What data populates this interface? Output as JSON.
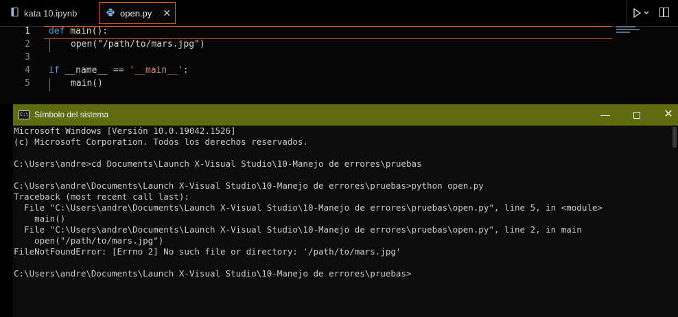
{
  "editor": {
    "tabs": [
      {
        "label": "kata 10.ipynb",
        "icon": "notebook-icon"
      },
      {
        "label": "open.py",
        "icon": "python-icon",
        "close": "✕"
      }
    ],
    "lines": [
      {
        "num": "1"
      },
      {
        "num": "2"
      },
      {
        "num": "3"
      },
      {
        "num": "4"
      },
      {
        "num": "5"
      }
    ],
    "code": {
      "l1_kw": "def",
      "l1_rest": " main():",
      "l2_fn": "open",
      "l2_open": "(",
      "l2_str": "\"/path/to/mars.jpg\"",
      "l2_close": ")",
      "l4_kw": "if",
      "l4_name": " __name__ ",
      "l4_op": "== ",
      "l4_str": "'__main__'",
      "l4_colon": ":",
      "l5_call": "main()"
    },
    "colors": {
      "keyword": "#569cd6",
      "string": "#ce9178",
      "active_border": "#d9532b"
    }
  },
  "console": {
    "title": "Símbolo del sistema",
    "icon_text": "C:\\",
    "controls": {
      "minimize": "—",
      "close": "✕"
    },
    "titlebar_color": "#5e6b0e",
    "lines": [
      "Microsoft Windows [Versión 10.0.19042.1526]",
      "(c) Microsoft Corporation. Todos los derechos reservados.",
      "",
      "C:\\Users\\andre>cd Documents\\Launch X-Visual Studio\\10-Manejo de errores\\pruebas",
      "",
      "C:\\Users\\andre\\Documents\\Launch X-Visual Studio\\10-Manejo de errores\\pruebas>python open.py",
      "Traceback (most recent call last):",
      "  File \"C:\\Users\\andre\\Documents\\Launch X-Visual Studio\\10-Manejo de errores\\pruebas\\open.py\", line 5, in <module>",
      "    main()",
      "  File \"C:\\Users\\andre\\Documents\\Launch X-Visual Studio\\10-Manejo de errores\\pruebas\\open.py\", line 2, in main",
      "    open(\"/path/to/mars.jpg\")",
      "FileNotFoundError: [Errno 2] No such file or directory: '/path/to/mars.jpg'",
      "",
      "C:\\Users\\andre\\Documents\\Launch X-Visual Studio\\10-Manejo de errores\\pruebas>"
    ]
  }
}
